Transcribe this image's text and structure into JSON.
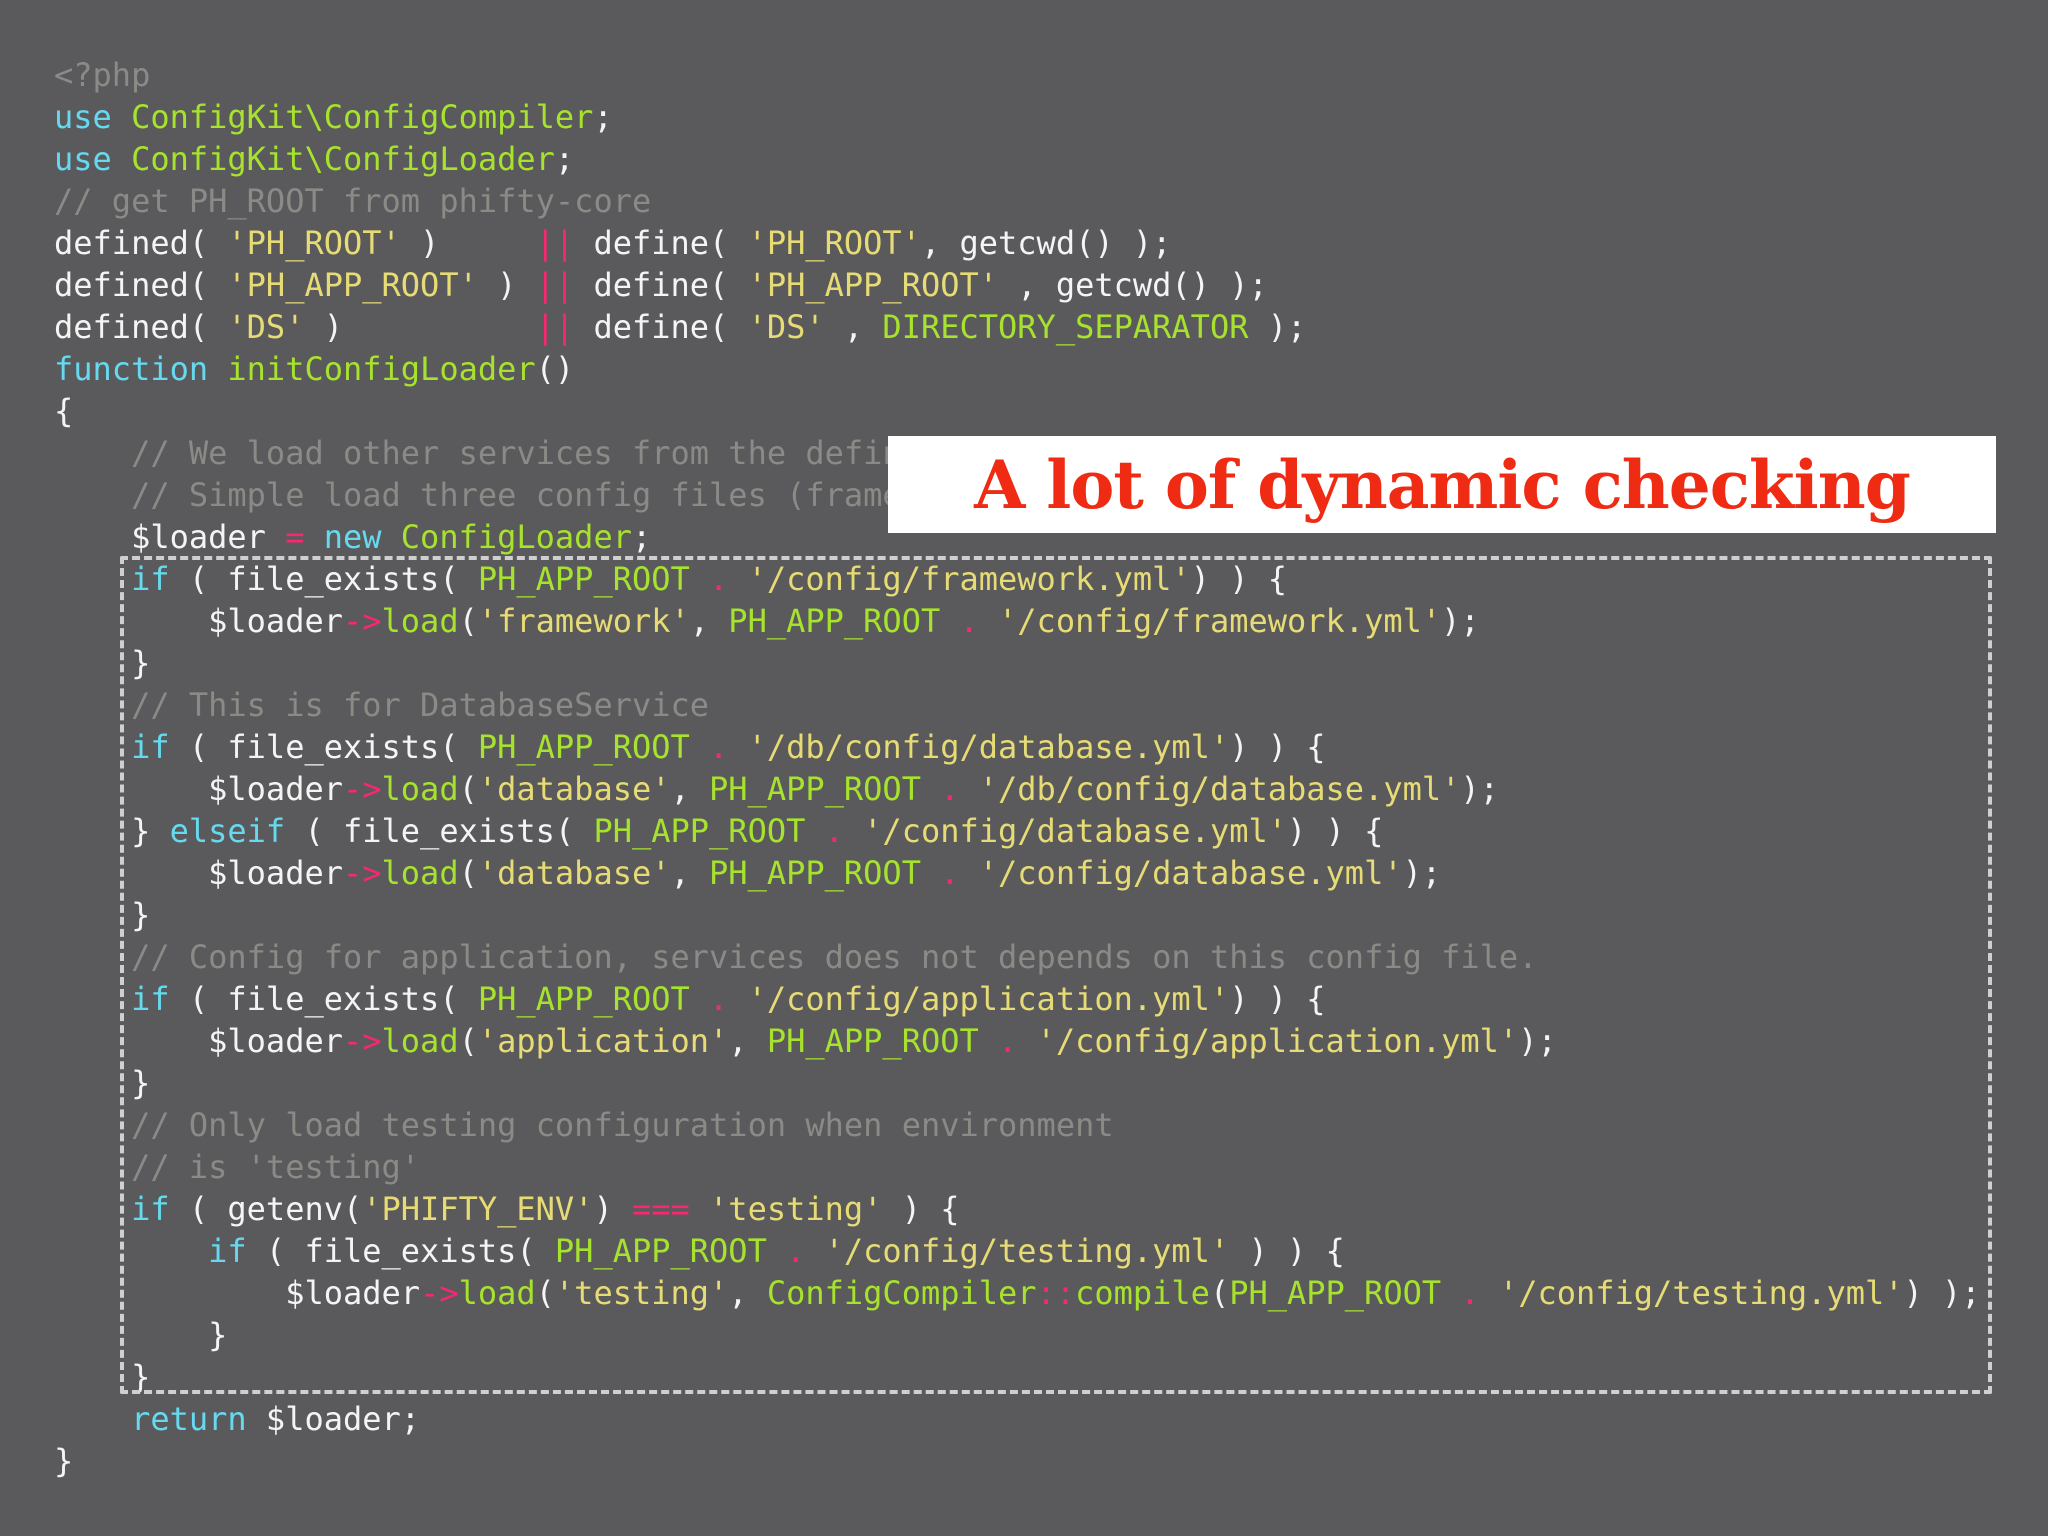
{
  "callout": {
    "text": "A lot of dynamic checking"
  },
  "colors": {
    "background": "#5a5a5c",
    "keyword": "#66d9ef",
    "class": "#a6e22e",
    "string": "#e6db74",
    "comment": "#8a8a86",
    "operator": "#f92672",
    "plain": "#f4f4f4",
    "callout_text": "#ef2b14"
  },
  "code_lines": [
    [
      [
        "cmt",
        "<?php"
      ]
    ],
    [
      [
        "kw",
        "use"
      ],
      [
        "pl",
        " "
      ],
      [
        "cls",
        "ConfigKit\\ConfigCompiler"
      ],
      [
        "pl",
        ";"
      ]
    ],
    [
      [
        "kw",
        "use"
      ],
      [
        "pl",
        " "
      ],
      [
        "cls",
        "ConfigKit\\ConfigLoader"
      ],
      [
        "pl",
        ";"
      ]
    ],
    [
      [
        "cmt",
        "// get PH_ROOT from phifty-core"
      ]
    ],
    [
      [
        "pl",
        "defined( "
      ],
      [
        "str",
        "'PH_ROOT'"
      ],
      [
        "pl",
        " )     "
      ],
      [
        "op",
        "||"
      ],
      [
        "pl",
        " define( "
      ],
      [
        "str",
        "'PH_ROOT'"
      ],
      [
        "pl",
        ", getcwd() );"
      ]
    ],
    [
      [
        "pl",
        "defined( "
      ],
      [
        "str",
        "'PH_APP_ROOT'"
      ],
      [
        "pl",
        " ) "
      ],
      [
        "op",
        "||"
      ],
      [
        "pl",
        " define( "
      ],
      [
        "str",
        "'PH_APP_ROOT'"
      ],
      [
        "pl",
        " , getcwd() );"
      ]
    ],
    [
      [
        "pl",
        "defined( "
      ],
      [
        "str",
        "'DS'"
      ],
      [
        "pl",
        " )          "
      ],
      [
        "op",
        "||"
      ],
      [
        "pl",
        " define( "
      ],
      [
        "str",
        "'DS'"
      ],
      [
        "pl",
        " , "
      ],
      [
        "cls",
        "DIRECTORY_SEPARATOR"
      ],
      [
        "pl",
        " );"
      ]
    ],
    [
      [
        "kw",
        "function"
      ],
      [
        "pl",
        " "
      ],
      [
        "cls",
        "initConfigLoader"
      ],
      [
        "pl",
        "()"
      ]
    ],
    [
      [
        "pl",
        "{"
      ]
    ],
    [
      [
        "pl",
        "    "
      ],
      [
        "cmt",
        "// We load other services from the defin"
      ]
    ],
    [
      [
        "pl",
        "    "
      ],
      [
        "cmt",
        "// Simple load three config files (frame"
      ]
    ],
    [
      [
        "pl",
        "    $loader "
      ],
      [
        "op",
        "="
      ],
      [
        "pl",
        " "
      ],
      [
        "kw",
        "new"
      ],
      [
        "pl",
        " "
      ],
      [
        "cls",
        "ConfigLoader"
      ],
      [
        "pl",
        ";"
      ]
    ],
    [
      [
        "pl",
        "    "
      ],
      [
        "kw",
        "if"
      ],
      [
        "pl",
        " ( file_exists( "
      ],
      [
        "cls",
        "PH_APP_ROOT"
      ],
      [
        "pl",
        " "
      ],
      [
        "op",
        "."
      ],
      [
        "pl",
        " "
      ],
      [
        "str",
        "'/config/framework.yml'"
      ],
      [
        "pl",
        ") ) {"
      ]
    ],
    [
      [
        "pl",
        "        $loader"
      ],
      [
        "op",
        "->"
      ],
      [
        "cls",
        "load"
      ],
      [
        "pl",
        "("
      ],
      [
        "str",
        "'framework'"
      ],
      [
        "pl",
        ", "
      ],
      [
        "cls",
        "PH_APP_ROOT"
      ],
      [
        "pl",
        " "
      ],
      [
        "op",
        "."
      ],
      [
        "pl",
        " "
      ],
      [
        "str",
        "'/config/framework.yml'"
      ],
      [
        "pl",
        ");"
      ]
    ],
    [
      [
        "pl",
        "    }"
      ]
    ],
    [
      [
        "pl",
        "    "
      ],
      [
        "cmt",
        "// This is for DatabaseService"
      ]
    ],
    [
      [
        "pl",
        "    "
      ],
      [
        "kw",
        "if"
      ],
      [
        "pl",
        " ( file_exists( "
      ],
      [
        "cls",
        "PH_APP_ROOT"
      ],
      [
        "pl",
        " "
      ],
      [
        "op",
        "."
      ],
      [
        "pl",
        " "
      ],
      [
        "str",
        "'/db/config/database.yml'"
      ],
      [
        "pl",
        ") ) {"
      ]
    ],
    [
      [
        "pl",
        "        $loader"
      ],
      [
        "op",
        "->"
      ],
      [
        "cls",
        "load"
      ],
      [
        "pl",
        "("
      ],
      [
        "str",
        "'database'"
      ],
      [
        "pl",
        ", "
      ],
      [
        "cls",
        "PH_APP_ROOT"
      ],
      [
        "pl",
        " "
      ],
      [
        "op",
        "."
      ],
      [
        "pl",
        " "
      ],
      [
        "str",
        "'/db/config/database.yml'"
      ],
      [
        "pl",
        ");"
      ]
    ],
    [
      [
        "pl",
        "    } "
      ],
      [
        "kw",
        "elseif"
      ],
      [
        "pl",
        " ( file_exists( "
      ],
      [
        "cls",
        "PH_APP_ROOT"
      ],
      [
        "pl",
        " "
      ],
      [
        "op",
        "."
      ],
      [
        "pl",
        " "
      ],
      [
        "str",
        "'/config/database.yml'"
      ],
      [
        "pl",
        ") ) {"
      ]
    ],
    [
      [
        "pl",
        "        $loader"
      ],
      [
        "op",
        "->"
      ],
      [
        "cls",
        "load"
      ],
      [
        "pl",
        "("
      ],
      [
        "str",
        "'database'"
      ],
      [
        "pl",
        ", "
      ],
      [
        "cls",
        "PH_APP_ROOT"
      ],
      [
        "pl",
        " "
      ],
      [
        "op",
        "."
      ],
      [
        "pl",
        " "
      ],
      [
        "str",
        "'/config/database.yml'"
      ],
      [
        "pl",
        ");"
      ]
    ],
    [
      [
        "pl",
        "    }"
      ]
    ],
    [
      [
        "pl",
        "    "
      ],
      [
        "cmt",
        "// Config for application, services does not depends on this config file."
      ]
    ],
    [
      [
        "pl",
        "    "
      ],
      [
        "kw",
        "if"
      ],
      [
        "pl",
        " ( file_exists( "
      ],
      [
        "cls",
        "PH_APP_ROOT"
      ],
      [
        "pl",
        " "
      ],
      [
        "op",
        "."
      ],
      [
        "pl",
        " "
      ],
      [
        "str",
        "'/config/application.yml'"
      ],
      [
        "pl",
        ") ) {"
      ]
    ],
    [
      [
        "pl",
        "        $loader"
      ],
      [
        "op",
        "->"
      ],
      [
        "cls",
        "load"
      ],
      [
        "pl",
        "("
      ],
      [
        "str",
        "'application'"
      ],
      [
        "pl",
        ", "
      ],
      [
        "cls",
        "PH_APP_ROOT"
      ],
      [
        "pl",
        " "
      ],
      [
        "op",
        "."
      ],
      [
        "pl",
        " "
      ],
      [
        "str",
        "'/config/application.yml'"
      ],
      [
        "pl",
        ");"
      ]
    ],
    [
      [
        "pl",
        "    }"
      ]
    ],
    [
      [
        "pl",
        "    "
      ],
      [
        "cmt",
        "// Only load testing configuration when environment"
      ]
    ],
    [
      [
        "pl",
        "    "
      ],
      [
        "cmt",
        "// is 'testing'"
      ]
    ],
    [
      [
        "pl",
        "    "
      ],
      [
        "kw",
        "if"
      ],
      [
        "pl",
        " ( getenv("
      ],
      [
        "str",
        "'PHIFTY_ENV'"
      ],
      [
        "pl",
        ") "
      ],
      [
        "op",
        "==="
      ],
      [
        "pl",
        " "
      ],
      [
        "str",
        "'testing'"
      ],
      [
        "pl",
        " ) {"
      ]
    ],
    [
      [
        "pl",
        "        "
      ],
      [
        "kw",
        "if"
      ],
      [
        "pl",
        " ( file_exists( "
      ],
      [
        "cls",
        "PH_APP_ROOT"
      ],
      [
        "pl",
        " "
      ],
      [
        "op",
        "."
      ],
      [
        "pl",
        " "
      ],
      [
        "str",
        "'/config/testing.yml'"
      ],
      [
        "pl",
        " ) ) {"
      ]
    ],
    [
      [
        "pl",
        "            $loader"
      ],
      [
        "op",
        "->"
      ],
      [
        "cls",
        "load"
      ],
      [
        "pl",
        "("
      ],
      [
        "str",
        "'testing'"
      ],
      [
        "pl",
        ", "
      ],
      [
        "cls",
        "ConfigCompiler"
      ],
      [
        "op",
        "::"
      ],
      [
        "cls",
        "compile"
      ],
      [
        "pl",
        "("
      ],
      [
        "cls",
        "PH_APP_ROOT"
      ],
      [
        "pl",
        " "
      ],
      [
        "op",
        "."
      ],
      [
        "pl",
        " "
      ],
      [
        "str",
        "'/config/testing.yml'"
      ],
      [
        "pl",
        ") );"
      ]
    ],
    [
      [
        "pl",
        "        }"
      ]
    ],
    [
      [
        "pl",
        "    }"
      ]
    ],
    [
      [
        "pl",
        "    "
      ],
      [
        "kw",
        "return"
      ],
      [
        "pl",
        " $loader;"
      ]
    ],
    [
      [
        "pl",
        "}"
      ]
    ]
  ]
}
